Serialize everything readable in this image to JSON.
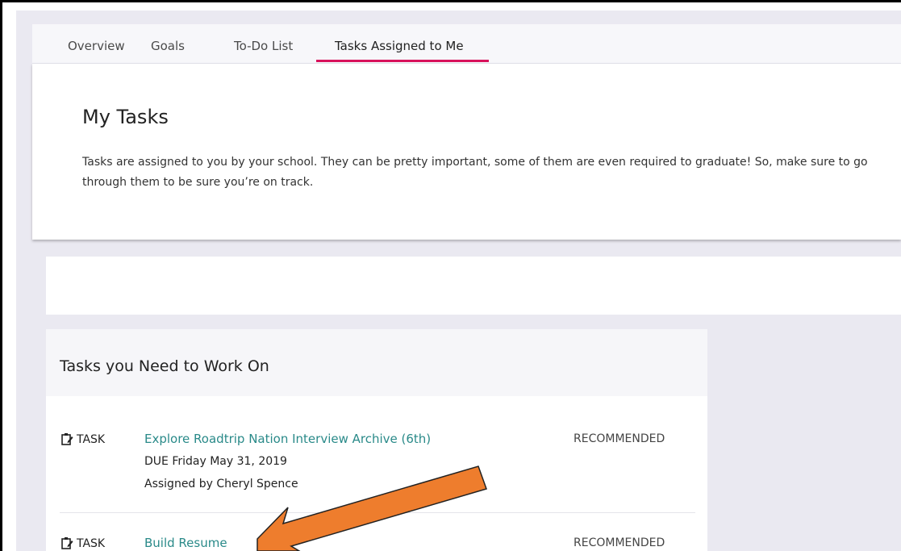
{
  "tabs": [
    {
      "label": "Overview"
    },
    {
      "label": "Goals"
    },
    {
      "label": "To-Do List"
    },
    {
      "label": "Tasks Assigned to Me"
    }
  ],
  "active_tab": "Tasks Assigned to Me",
  "header_card": {
    "title": "My Tasks",
    "description": "Tasks are assigned to you by your school. They can be pretty important, some of them are even required to graduate! So, make sure to go through them to be sure you’re on track."
  },
  "tasks_section": {
    "title": "Tasks you Need to Work On",
    "tasks": [
      {
        "type": "TASK",
        "type_icon": "clipboard-icon",
        "title": "Explore Roadtrip Nation Interview Archive (6th)",
        "status": "RECOMMENDED",
        "due": "DUE   Friday May 31, 2019",
        "assigned_by": "Assigned by Cheryl Spence"
      },
      {
        "type": "TASK",
        "type_icon": "clipboard-icon",
        "title": "Build Resume",
        "status": "RECOMMENDED"
      }
    ]
  },
  "colors": {
    "accent": "#d8125b",
    "link": "#2a8a89",
    "annotation_arrow": "#ee7d2d",
    "background": "#eae9f1"
  }
}
